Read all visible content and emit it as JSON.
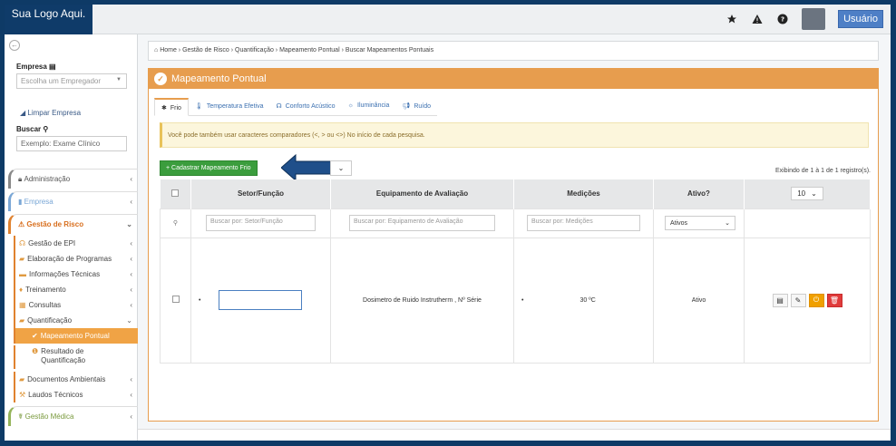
{
  "logo": {
    "text": "Sua Logo Aqui."
  },
  "topbar": {
    "icons": [
      "star-icon",
      "warning-icon",
      "help-icon"
    ],
    "user_label": "Usuário"
  },
  "sidebar": {
    "empresa_label": "Empresa",
    "empresa_placeholder": "Escolha um Empregador",
    "limpar_label": "Limpar Empresa",
    "buscar_label": "Buscar",
    "buscar_placeholder": "Exemplo: Exame Clínico",
    "groups": {
      "administracao": "Administração",
      "empresa": "Empresa",
      "gestao_risco": "Gestão de Risco",
      "gestao_medica": "Gestão Médica"
    },
    "subs": [
      {
        "label": "Gestão de EPI",
        "icon": "epi-icon"
      },
      {
        "label": "Elaboração de Programas",
        "icon": "book-icon"
      },
      {
        "label": "Informações Técnicas",
        "icon": "folder-icon"
      },
      {
        "label": "Treinamento",
        "icon": "training-icon"
      },
      {
        "label": "Consultas",
        "icon": "table-icon"
      },
      {
        "label": "Quantificação",
        "icon": "book-icon"
      },
      {
        "label": "Mapeamento Pontual",
        "icon": "check-icon"
      },
      {
        "label": "Resultado de Quantificação",
        "icon": "info-icon"
      },
      {
        "label": "Documentos Ambientais",
        "icon": "book-icon"
      },
      {
        "label": "Laudos Técnicos",
        "icon": "gavel-icon"
      }
    ]
  },
  "breadcrumb": {
    "items": [
      "Home",
      "Gestão de Risco",
      "Quantificação",
      "Mapeamento Pontual",
      "Buscar Mapeamentos Pontuais"
    ],
    "text": "Home › Gestão de Risco › Quantificação › Mapeamento Pontual › Buscar Mapeamentos Pontuais"
  },
  "panel": {
    "title": "Mapeamento Pontual",
    "tabs": [
      {
        "label": "Frio",
        "icon": "snow-icon"
      },
      {
        "label": "Temperatura Efetiva",
        "icon": "thermometer-icon"
      },
      {
        "label": "Conforto Acústico",
        "icon": "headphones-icon"
      },
      {
        "label": "Iluminância",
        "icon": "bulb-icon"
      },
      {
        "label": "Ruído",
        "icon": "megaphone-icon"
      }
    ],
    "alert": "Você pode também usar caracteres comparadores (<, > ou <>) No início de cada pesquisa.",
    "add_button": "+ Cadastrar Mapeamento Frio",
    "records": "Exibindo de 1 à 1 de 1 registro(s).",
    "page_length": "10"
  },
  "table": {
    "headers": [
      "Setor/Função",
      "Equipamento de Avaliação",
      "Medições",
      "Ativo?"
    ],
    "filters": {
      "setor": "Buscar por: Setor/Função",
      "equip": "Buscar por: Equipamento de Avaliação",
      "medicoes": "Buscar por: Medições",
      "ativo": "Ativos"
    },
    "rows": [
      {
        "setor": "",
        "equipamento": "Dosimetro de Ruido Instrutherm , Nº Série",
        "medicao": "30 ºC",
        "ativo": "Ativo"
      }
    ]
  },
  "colors": {
    "accent": "#e79d4e",
    "brand": "#0f3b69",
    "green": "#3b9d3d"
  }
}
